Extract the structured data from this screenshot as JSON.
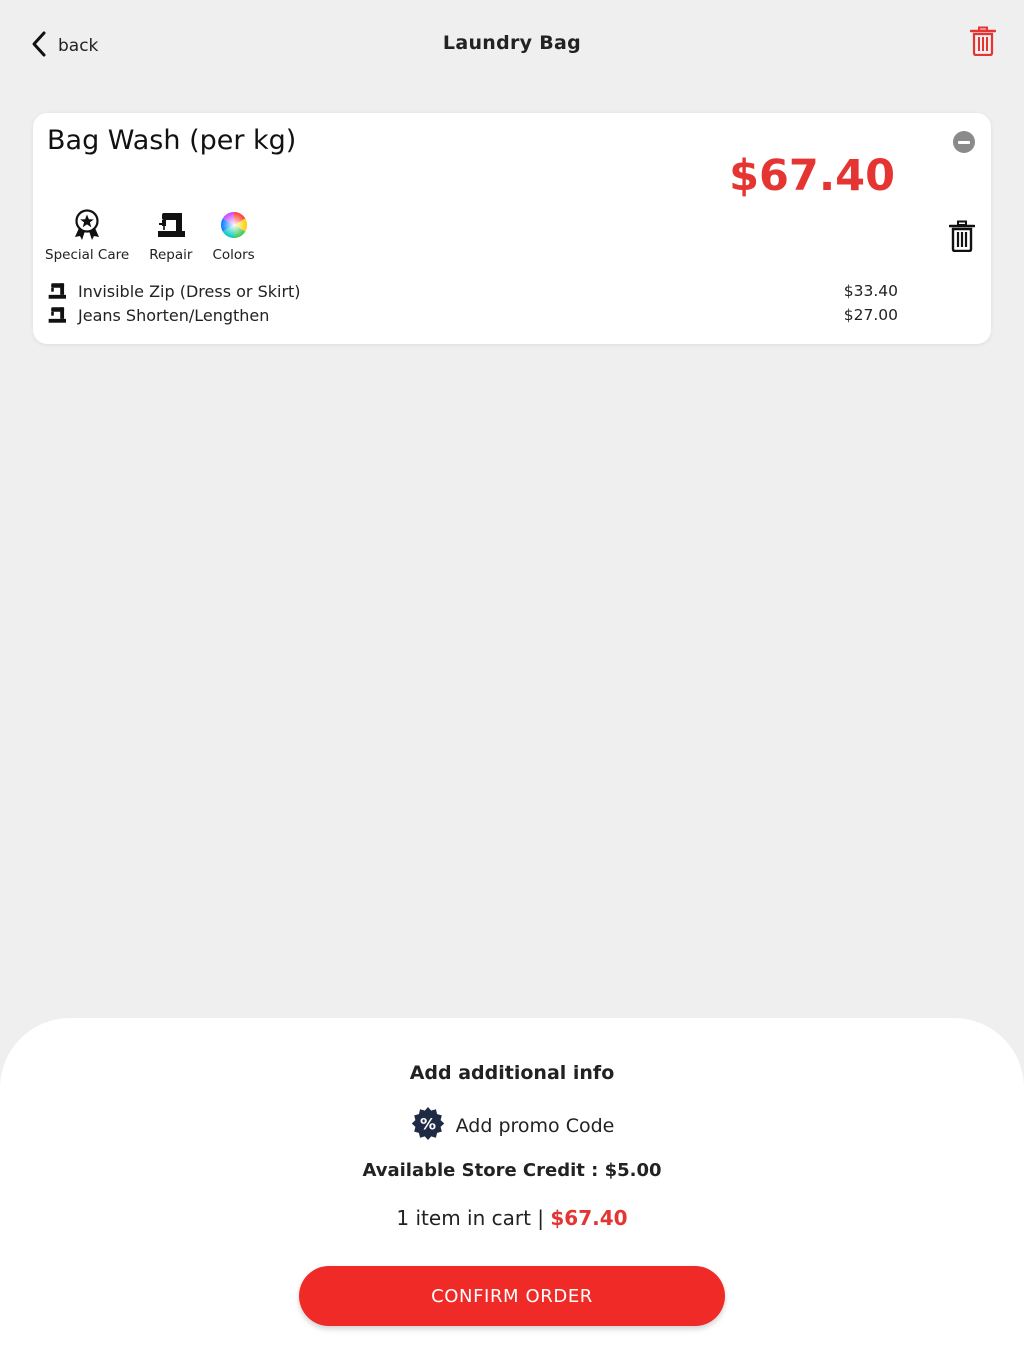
{
  "header": {
    "back_label": "back",
    "title": "Laundry Bag",
    "icons": {
      "back": "chevron-left-icon",
      "delete_all": "trash-icon"
    }
  },
  "cart_item": {
    "name": "Bag Wash (per kg)",
    "price": "$67.40",
    "options": [
      {
        "label": "Special Care",
        "icon": "award-star-icon"
      },
      {
        "label": "Repair",
        "icon": "sewing-machine-icon"
      },
      {
        "label": "Colors",
        "icon": "color-wheel-icon"
      }
    ],
    "addons": [
      {
        "name": "Invisible Zip (Dress or Skirt)",
        "price": "$33.40",
        "icon": "sewing-machine-icon"
      },
      {
        "name": "Jeans Shorten/Lengthen",
        "price": "$27.00",
        "icon": "sewing-machine-icon"
      }
    ]
  },
  "summary": {
    "additional_info": "Add additional info",
    "promo_label": "Add promo Code",
    "store_credit": "Available Store Credit : $5.00",
    "cart_count": "1 item in cart | ",
    "cart_total": "$67.40",
    "confirm_label": "CONFIRM ORDER"
  },
  "colors": {
    "accent": "#e53532",
    "button": "#f02a26",
    "background": "#efefef",
    "promo_badge": "#1f2a44"
  }
}
